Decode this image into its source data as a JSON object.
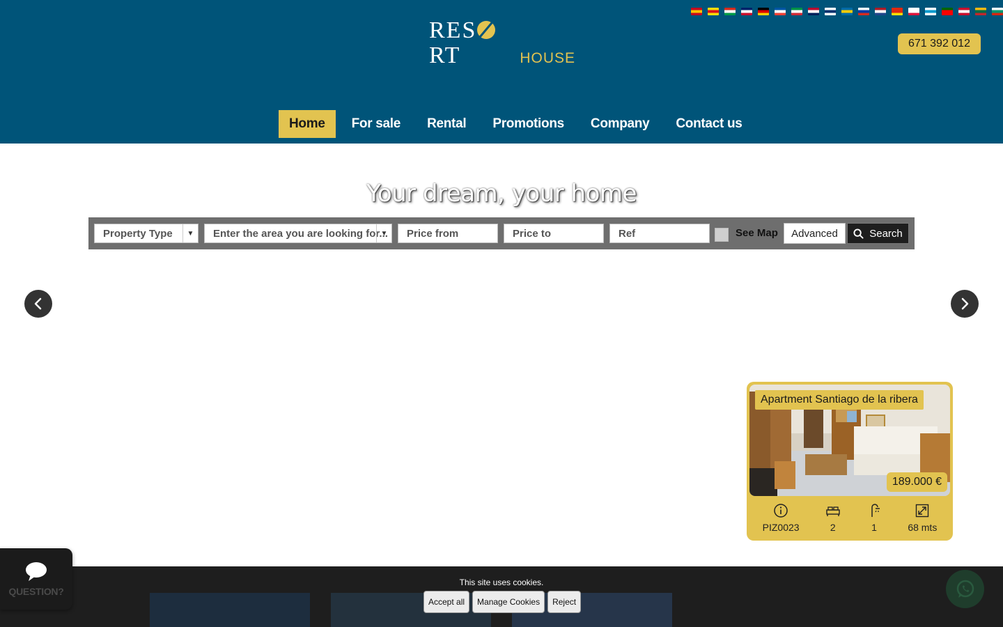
{
  "header": {
    "phone": "671 392 012",
    "logo": {
      "main_left": "RES",
      "main_right": "RT",
      "sub": "HOUSE"
    },
    "flags": [
      {
        "name": "spanish-flag",
        "colors": [
          "#c60b1e",
          "#ffc400",
          "#c60b1e"
        ]
      },
      {
        "name": "catalan-flag",
        "colors": [
          "#fcdd09",
          "#da121a",
          "#fcdd09"
        ]
      },
      {
        "name": "basque-flag",
        "colors": [
          "#d52b1e",
          "#ffffff",
          "#009b48"
        ]
      },
      {
        "name": "english-flag",
        "colors": [
          "#012169",
          "#ffffff",
          "#c8102e"
        ]
      },
      {
        "name": "german-flag",
        "colors": [
          "#000000",
          "#dd0000",
          "#ffce00"
        ]
      },
      {
        "name": "french-flag",
        "colors": [
          "#0055a4",
          "#ffffff",
          "#ef4135"
        ]
      },
      {
        "name": "italian-flag",
        "colors": [
          "#009246",
          "#ffffff",
          "#ce2b37"
        ]
      },
      {
        "name": "norwegian-flag",
        "colors": [
          "#ba0c2f",
          "#ffffff",
          "#00205b"
        ]
      },
      {
        "name": "finnish-flag",
        "colors": [
          "#ffffff",
          "#002f6c",
          "#ffffff"
        ]
      },
      {
        "name": "swedish-flag",
        "colors": [
          "#006aa7",
          "#fecc00",
          "#006aa7"
        ]
      },
      {
        "name": "russian-flag",
        "colors": [
          "#ffffff",
          "#0039a6",
          "#d52b1e"
        ]
      },
      {
        "name": "dutch-flag",
        "colors": [
          "#ae1c28",
          "#ffffff",
          "#21468b"
        ]
      },
      {
        "name": "chinese-flag",
        "colors": [
          "#de2910",
          "#de2910",
          "#ffde00"
        ]
      },
      {
        "name": "polish-flag",
        "colors": [
          "#ffffff",
          "#ffffff",
          "#dc143c"
        ]
      },
      {
        "name": "galician-flag",
        "colors": [
          "#ffffff",
          "#0099cc",
          "#ffffff"
        ]
      },
      {
        "name": "portuguese-flag",
        "colors": [
          "#006600",
          "#ff0000",
          "#ff0000"
        ]
      },
      {
        "name": "danish-flag",
        "colors": [
          "#c8102e",
          "#ffffff",
          "#c8102e"
        ]
      },
      {
        "name": "lithuanian-flag",
        "colors": [
          "#fdb913",
          "#006a44",
          "#c1272d"
        ]
      },
      {
        "name": "bulgarian-flag",
        "colors": [
          "#ffffff",
          "#00966e",
          "#d62612"
        ]
      }
    ],
    "nav": [
      {
        "label": "Home",
        "active": true
      },
      {
        "label": "For sale",
        "active": false
      },
      {
        "label": "Rental",
        "active": false
      },
      {
        "label": "Promotions",
        "active": false
      },
      {
        "label": "Company",
        "active": false
      },
      {
        "label": "Contact us",
        "active": false
      }
    ]
  },
  "hero": {
    "title": "Your dream, your home"
  },
  "search": {
    "property_type": "Property Type",
    "area": "Enter the area you are looking for...",
    "price_from": "Price from",
    "price_to": "Price to",
    "ref": "Ref",
    "see_map": "See Map",
    "advanced": "Advanced",
    "search": "Search"
  },
  "card": {
    "title": "Apartment Santiago de la ribera",
    "price": "189.000 €",
    "ref": "PIZ0023",
    "bedrooms": "2",
    "bathrooms": "1",
    "size": "68 mts"
  },
  "widgets": {
    "question": "QUESTION?"
  },
  "cookies": {
    "text": "This site uses cookies.",
    "accept": "Accept all",
    "manage": "Manage Cookies",
    "reject": "Reject"
  },
  "colors": {
    "header_bg": "#005479",
    "accent": "#e2c350",
    "dark": "#1e1e1e"
  }
}
